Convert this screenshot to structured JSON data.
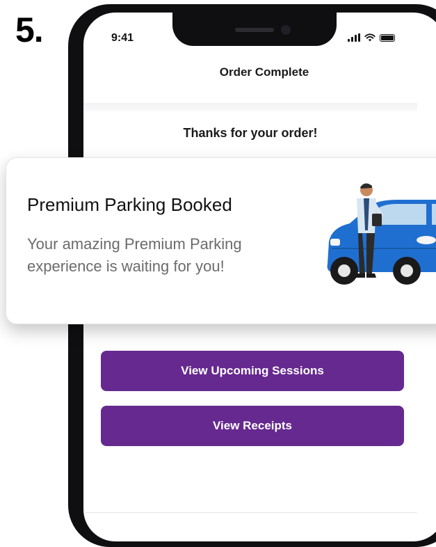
{
  "step": {
    "number": "5."
  },
  "status_bar": {
    "time": "9:41"
  },
  "nav": {
    "title": "Order Complete"
  },
  "confirmation": {
    "message": "Thanks for your order!"
  },
  "notification": {
    "title": "Premium Parking Booked",
    "body": "Your amazing Premium Parking experience is waiting for you!",
    "illustration": "man-with-car-illustration"
  },
  "actions": {
    "upcoming_label": "View Upcoming Sessions",
    "receipts_label": "View Receipts"
  },
  "colors": {
    "primary_button": "#66298f",
    "car": "#1f6fd1",
    "text_dark": "#111111",
    "text_muted": "#6b6b6b"
  }
}
